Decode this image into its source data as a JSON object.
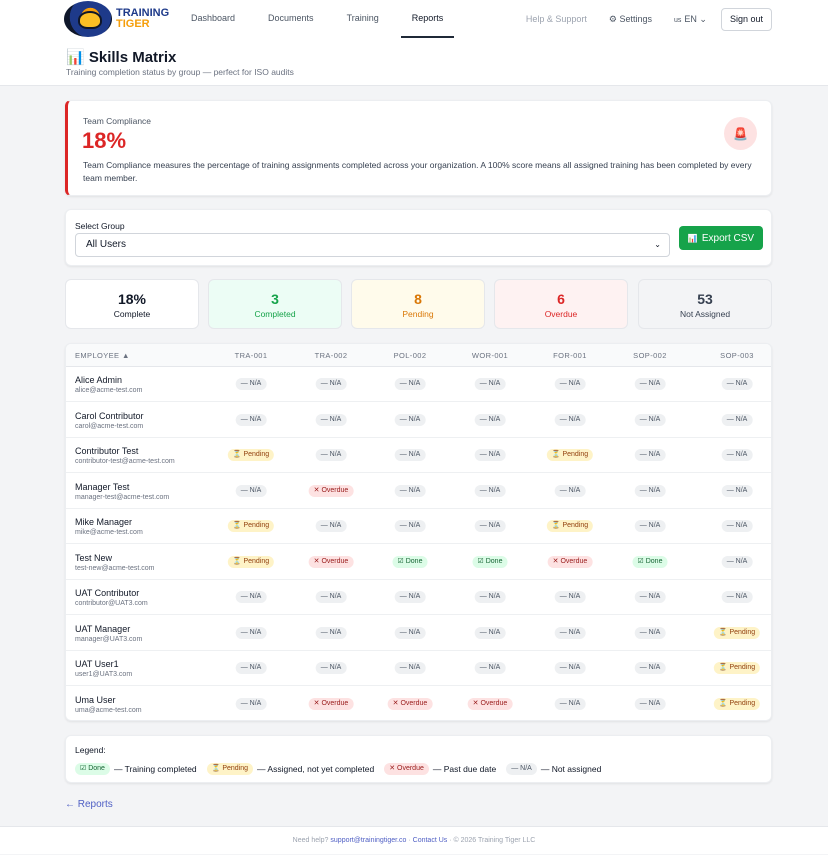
{
  "brand": {
    "line1": "TRAINING",
    "line2": "TIGER"
  },
  "nav": [
    {
      "label": "Dashboard",
      "active": false
    },
    {
      "label": "Documents",
      "active": false
    },
    {
      "label": "Training",
      "active": false
    },
    {
      "label": "Reports",
      "active": true
    }
  ],
  "right_nav": {
    "help": "Help & Support",
    "settings": "Settings",
    "lang_flag": "us",
    "lang": "EN",
    "signout": "Sign out"
  },
  "page": {
    "title": "Skills Matrix",
    "subtitle": "Training completion status by group — perfect for ISO audits"
  },
  "compliance": {
    "label": "Team Compliance",
    "value": "18%",
    "description": "Team Compliance measures the percentage of training assignments completed across your organization. A 100% score means all assigned training has been completed by every team member."
  },
  "group": {
    "label": "Select Group",
    "selected": "All Users",
    "export_label": "Export CSV"
  },
  "stats": [
    {
      "value": "18%",
      "label": "Complete",
      "bg": "#ffffff",
      "color": "#111827"
    },
    {
      "value": "3",
      "label": "Completed",
      "bg": "#ecfdf5",
      "color": "#16a34a"
    },
    {
      "value": "8",
      "label": "Pending",
      "bg": "#fffbeb",
      "color": "#d97706"
    },
    {
      "value": "6",
      "label": "Overdue",
      "bg": "#fef2f2",
      "color": "#dc2626"
    },
    {
      "value": "53",
      "label": "Not Assigned",
      "bg": "#f3f4f6",
      "color": "#374151"
    }
  ],
  "status_labels": {
    "na": "— N/A",
    "pending": "⏳ Pending",
    "overdue": "✕ Overdue",
    "done": "☑ Done"
  },
  "table": {
    "employee_header": "EMPLOYEE ▲",
    "columns": [
      "TRA-001",
      "TRA-002",
      "POL-002",
      "WOR-001",
      "FOR-001",
      "SOP-002",
      "SOP-003"
    ],
    "rows": [
      {
        "name": "Alice Admin",
        "email": "alice@acme-test.com",
        "status": [
          "na",
          "na",
          "na",
          "na",
          "na",
          "na",
          "na"
        ]
      },
      {
        "name": "Carol Contributor",
        "email": "carol@acme-test.com",
        "status": [
          "na",
          "na",
          "na",
          "na",
          "na",
          "na",
          "na"
        ]
      },
      {
        "name": "Contributor Test",
        "email": "contributor-test@acme-test.com",
        "status": [
          "pending",
          "na",
          "na",
          "na",
          "pending",
          "na",
          "na"
        ]
      },
      {
        "name": "Manager Test",
        "email": "manager-test@acme-test.com",
        "status": [
          "na",
          "overdue",
          "na",
          "na",
          "na",
          "na",
          "na"
        ]
      },
      {
        "name": "Mike Manager",
        "email": "mike@acme-test.com",
        "status": [
          "pending",
          "na",
          "na",
          "na",
          "pending",
          "na",
          "na"
        ]
      },
      {
        "name": "Test New",
        "email": "test-new@acme-test.com",
        "status": [
          "pending",
          "overdue",
          "done",
          "done",
          "overdue",
          "done",
          "na"
        ]
      },
      {
        "name": "UAT Contributor",
        "email": "contributor@UAT3.com",
        "status": [
          "na",
          "na",
          "na",
          "na",
          "na",
          "na",
          "na"
        ]
      },
      {
        "name": "UAT Manager",
        "email": "manager@UAT3.com",
        "status": [
          "na",
          "na",
          "na",
          "na",
          "na",
          "na",
          "pending"
        ]
      },
      {
        "name": "UAT User1",
        "email": "user1@UAT3.com",
        "status": [
          "na",
          "na",
          "na",
          "na",
          "na",
          "na",
          "pending"
        ]
      },
      {
        "name": "Uma User",
        "email": "uma@acme-test.com",
        "status": [
          "na",
          "overdue",
          "overdue",
          "overdue",
          "na",
          "na",
          "pending"
        ]
      }
    ]
  },
  "legend": {
    "title": "Legend:",
    "items": [
      {
        "status": "done",
        "text": "— Training completed"
      },
      {
        "status": "pending",
        "text": "— Assigned, not yet completed"
      },
      {
        "status": "overdue",
        "text": "— Past due date"
      },
      {
        "status": "na",
        "text": "— Not assigned"
      }
    ]
  },
  "back_link": "← Reports",
  "footer": {
    "prefix": "Need help?",
    "email": "support@trainingtiger.co",
    "sep1": "·",
    "contact": "Contact Us",
    "sep2": "·",
    "copyright": "© 2026 Training Tiger LLC"
  }
}
